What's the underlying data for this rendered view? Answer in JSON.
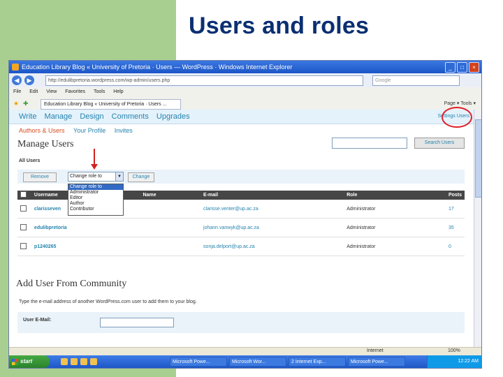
{
  "slide": {
    "title": "Users and roles"
  },
  "window": {
    "title": "Education Library Blog « University of Pretoria · Users — WordPress · Windows Internet Explorer"
  },
  "browser": {
    "url": "http://edulibpretoria.wordpress.com/wp-admin/users.php",
    "search_placeholder": "Google",
    "menu": [
      "File",
      "Edit",
      "View",
      "Favorites",
      "Tools",
      "Help"
    ],
    "tab_title": "Education Library Blog « University of Pretoria · Users ...",
    "tools_label": "Page ▾   Tools ▾"
  },
  "wp": {
    "menu": [
      "Write",
      "Manage",
      "Design",
      "Comments",
      "Upgrades"
    ],
    "right_links": "Settings   Users",
    "submenu": {
      "active": "Authors & Users",
      "others": [
        "Your Profile",
        "Invites"
      ]
    },
    "page_title": "Manage Users",
    "search_button": "Search Users",
    "all_users": "All Users",
    "remove_button": "Remove",
    "role_select": "Change role to",
    "change_button": "Change",
    "role_options": [
      "Change role to",
      "Administrator",
      "Editor",
      "Author",
      "Contributor"
    ],
    "table": {
      "headers": [
        "Username",
        "Name",
        "E-mail",
        "Role",
        "Posts"
      ],
      "rows": [
        {
          "username": "clarisseven",
          "name": "",
          "email": "clarisse.venter@up.ac.za",
          "role": "Administrator",
          "posts": "17"
        },
        {
          "username": "edulibpretoria",
          "name": "",
          "email": "johann.vanwyk@up.ac.za",
          "role": "Administrator",
          "posts": "35"
        },
        {
          "username": "p1240265",
          "name": "",
          "email": "sonja.delport@up.ac.za",
          "role": "Administrator",
          "posts": "0"
        }
      ]
    },
    "add_title": "Add User From Community",
    "add_desc": "Type the e-mail address of another WordPress.com user to add them to your blog.",
    "add_label": "User E-Mail:"
  },
  "status": {
    "zone": "Internet",
    "zoom": "100%"
  },
  "taskbar": {
    "start": "start",
    "buttons": [
      "Microsoft Powe...",
      "Microsoft Wor...",
      "2 Internet Exp...",
      "Microsoft Powe..."
    ],
    "clock": "12:22 AM"
  },
  "colors": {
    "slide_green": "#a9cf90",
    "title_blue": "#0b2f72",
    "wp_link": "#2583ad",
    "highlight_red": "#e0202a"
  }
}
